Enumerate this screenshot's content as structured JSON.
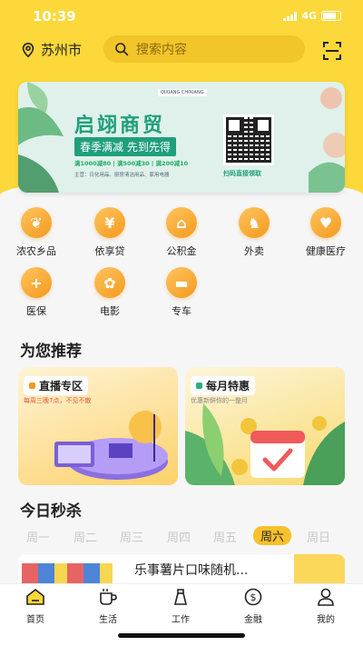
{
  "status": {
    "time": "10:39",
    "network": "4G"
  },
  "header": {
    "city": "苏州市",
    "search_placeholder": "搜索内容"
  },
  "banner": {
    "logo_text": "QIXIANG CHIXIANG",
    "title": "启翊商贸",
    "subtitle": "春季满减 先到先得",
    "deals": "满1000减80 | 满500减30 | 满200减10",
    "categories": "主营：日化用品、厨房清洁用品、家用电器",
    "qr_label": "扫码直接领取"
  },
  "services": [
    {
      "label": "浓农乡品",
      "icon": "leaf-icon"
    },
    {
      "label": "依享贷",
      "icon": "yen-icon"
    },
    {
      "label": "公积金",
      "icon": "house-icon"
    },
    {
      "label": "外卖",
      "icon": "scooter-icon"
    },
    {
      "label": "健康医疗",
      "icon": "health-icon"
    },
    {
      "label": "医保",
      "icon": "plus-icon"
    },
    {
      "label": "电影",
      "icon": "film-icon"
    },
    {
      "label": "专车",
      "icon": "car-icon"
    }
  ],
  "recommend": {
    "title": "为您推荐",
    "cards": [
      {
        "title": "直播专区",
        "subtitle": "每周三晚7点，不见不散"
      },
      {
        "title": "每月特惠",
        "subtitle": "优惠新鲜你的一整月"
      }
    ]
  },
  "flash": {
    "title": "今日秒杀",
    "days": [
      "周一",
      "周二",
      "周三",
      "周四",
      "周五",
      "周六",
      "周日"
    ],
    "active_day": "周六",
    "product_name": "乐事薯片口味随机..."
  },
  "tabbar": [
    {
      "label": "首页",
      "icon": "home-icon"
    },
    {
      "label": "生活",
      "icon": "cup-icon"
    },
    {
      "label": "工作",
      "icon": "work-icon"
    },
    {
      "label": "金融",
      "icon": "dollar-icon"
    },
    {
      "label": "我的",
      "icon": "profile-icon"
    }
  ]
}
